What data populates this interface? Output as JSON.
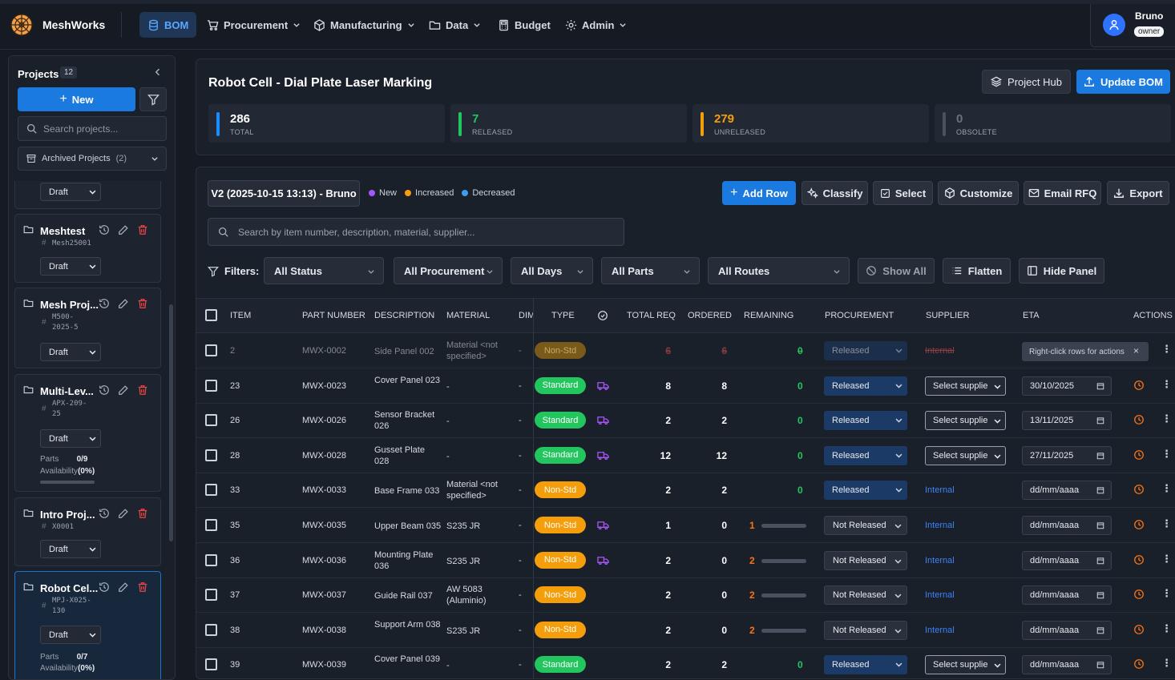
{
  "app": {
    "name": "MeshWorks"
  },
  "nav": {
    "items": [
      {
        "label": "BOM",
        "icon": "database-icon",
        "active": true
      },
      {
        "label": "Procurement",
        "icon": "cart-icon"
      },
      {
        "label": "Manufacturing",
        "icon": "cube-icon"
      },
      {
        "label": "Data",
        "icon": "folder-icon"
      },
      {
        "label": "Budget",
        "icon": "calculator-icon"
      },
      {
        "label": "Admin",
        "icon": "gear-icon"
      }
    ]
  },
  "user": {
    "name": "Bruno",
    "role": "owner"
  },
  "sidebar": {
    "title": "Projects",
    "count": "12",
    "new_label": "New",
    "search_placeholder": "Search projects...",
    "archived_label": "Archived Projects",
    "archived_count": "(2)",
    "status_label": "Draft",
    "projects": [
      {
        "name": "Meshtest",
        "code": "Mesh25001"
      },
      {
        "name": "Mesh Proj...",
        "code_lines": [
          "M500-",
          "2025-5"
        ]
      },
      {
        "name": "Multi-Lev...",
        "code_lines": [
          "APX-209-",
          "25"
        ],
        "parts_label": "Parts",
        "parts": "0/9",
        "availability_label": "Availability",
        "availability": "(0%)"
      },
      {
        "name": "Intro Proj...",
        "code": "X0001"
      },
      {
        "name": "Robot Cel...",
        "code_lines": [
          "MPJ-X025-",
          "130"
        ],
        "parts_label": "Parts",
        "parts": "0/7",
        "availability_label": "Availability",
        "availability": "(0%)",
        "selected": true
      }
    ]
  },
  "project": {
    "title": "Robot Cell - Dial Plate Laser Marking",
    "hub_label": "Project Hub",
    "update_label": "Update BOM",
    "stats": [
      {
        "value": "286",
        "label": "TOTAL",
        "color": "#1a8cff"
      },
      {
        "value": "7",
        "label": "RELEASED",
        "color": "#22c55e"
      },
      {
        "value": "279",
        "label": "UNRELEASED",
        "color": "#f59e0b"
      },
      {
        "value": "0",
        "label": "OBSOLETE",
        "color": "#4a5260"
      }
    ]
  },
  "bom": {
    "version": "V2 (2025-10-15 13:13) - Bruno",
    "legend": [
      {
        "label": "New",
        "color": "#a855f7"
      },
      {
        "label": "Increased",
        "color": "#f59e0b"
      },
      {
        "label": "Decreased",
        "color": "#3b9cf0"
      }
    ],
    "toolbar": {
      "add_row": "Add Row",
      "classify": "Classify",
      "select": "Select",
      "customize": "Customize",
      "email_rfq": "Email RFQ",
      "export": "Export"
    },
    "search_placeholder": "Search by item number, description, material, supplier...",
    "filters": {
      "label": "Filters:",
      "status": "All Status",
      "procurement": "All Procurement",
      "days": "All Days",
      "parts": "All Parts",
      "routes": "All Routes",
      "show_all": "Show All",
      "flatten": "Flatten",
      "hide_panel": "Hide Panel"
    },
    "columns": {
      "item": "ITEM",
      "part_number": "PART NUMBER",
      "description": "DESCRIPTION",
      "material": "MATERIAL",
      "dim": "DIM",
      "type": "TYPE",
      "total_req": "TOTAL REQ",
      "ordered": "ORDERED",
      "remaining": "REMAINING",
      "procurement": "PROCUREMENT",
      "supplier": "SUPPLIER",
      "eta": "ETA",
      "actions": "ACTIONS"
    },
    "tooltip": "Right-click rows for actions",
    "rows": [
      {
        "item": "2",
        "part": "MWX-0002",
        "desc": "Side Panel 002",
        "mat": "Material <not specified>",
        "dim": "-",
        "type": "Non-Std",
        "truck": false,
        "total": "6",
        "ordered": "6",
        "remaining": "0",
        "remaining_fraction": 0,
        "proc": "Released",
        "supplier": "Internal",
        "eta": "",
        "dim_row": true
      },
      {
        "item": "23",
        "part": "MWX-0023",
        "desc": "Cover Panel 023",
        "mat": "-",
        "dim": "-",
        "type": "Standard",
        "truck": true,
        "total": "8",
        "ordered": "8",
        "remaining": "0",
        "remaining_fraction": 0,
        "proc": "Released",
        "supplier": "Select supplie",
        "eta": "30/10/2025"
      },
      {
        "item": "26",
        "part": "MWX-0026",
        "desc": "Sensor Bracket 026",
        "mat": "-",
        "dim": "-",
        "type": "Standard",
        "truck": true,
        "total": "2",
        "ordered": "2",
        "remaining": "0",
        "remaining_fraction": 0,
        "proc": "Released",
        "supplier": "Select supplie",
        "eta": "13/11/2025"
      },
      {
        "item": "28",
        "part": "MWX-0028",
        "desc": "Gusset Plate 028",
        "mat": "-",
        "dim": "-",
        "type": "Standard",
        "truck": true,
        "total": "12",
        "ordered": "12",
        "remaining": "0",
        "remaining_fraction": 0,
        "proc": "Released",
        "supplier": "Select supplie",
        "eta": "27/11/2025"
      },
      {
        "item": "33",
        "part": "MWX-0033",
        "desc": "Base Frame 033",
        "mat": "Material <not specified>",
        "dim": "-",
        "type": "Non-Std",
        "truck": false,
        "total": "2",
        "ordered": "2",
        "remaining": "0",
        "remaining_fraction": 0,
        "proc": "Released",
        "supplier": "Internal",
        "eta": "dd/mm/aaaa"
      },
      {
        "item": "35",
        "part": "MWX-0035",
        "desc": "Upper Beam 035",
        "mat": "S235 JR",
        "dim": "-",
        "type": "Non-Std",
        "truck": true,
        "total": "1",
        "ordered": "0",
        "remaining": "1",
        "remaining_fraction": 1,
        "proc": "Not Released",
        "supplier": "Internal",
        "eta": "dd/mm/aaaa"
      },
      {
        "item": "36",
        "part": "MWX-0036",
        "desc": "Mounting Plate 036",
        "mat": "S235 JR",
        "dim": "-",
        "type": "Non-Std",
        "truck": true,
        "total": "2",
        "ordered": "0",
        "remaining": "2",
        "remaining_fraction": 1,
        "proc": "Not Released",
        "supplier": "Internal",
        "eta": "dd/mm/aaaa"
      },
      {
        "item": "37",
        "part": "MWX-0037",
        "desc": "Guide Rail 037",
        "mat": "AW 5083 (Aluminio)",
        "dim": "-",
        "type": "Non-Std",
        "truck": false,
        "total": "2",
        "ordered": "0",
        "remaining": "2",
        "remaining_fraction": 1,
        "proc": "Not Released",
        "supplier": "Internal",
        "eta": "dd/mm/aaaa"
      },
      {
        "item": "38",
        "part": "MWX-0038",
        "desc": "Support Arm 038",
        "mat": "S235 JR",
        "dim": "-",
        "type": "Non-Std",
        "truck": false,
        "total": "2",
        "ordered": "0",
        "remaining": "2",
        "remaining_fraction": 1,
        "proc": "Not Released",
        "supplier": "Internal",
        "eta": "dd/mm/aaaa"
      },
      {
        "item": "39",
        "part": "MWX-0039",
        "desc": "Cover Panel 039",
        "mat": "-",
        "dim": "-",
        "type": "Standard",
        "truck": false,
        "total": "2",
        "ordered": "2",
        "remaining": "0",
        "remaining_fraction": 0,
        "proc": "Released",
        "supplier": "Select supplie",
        "eta": "dd/mm/aaaa"
      }
    ]
  }
}
